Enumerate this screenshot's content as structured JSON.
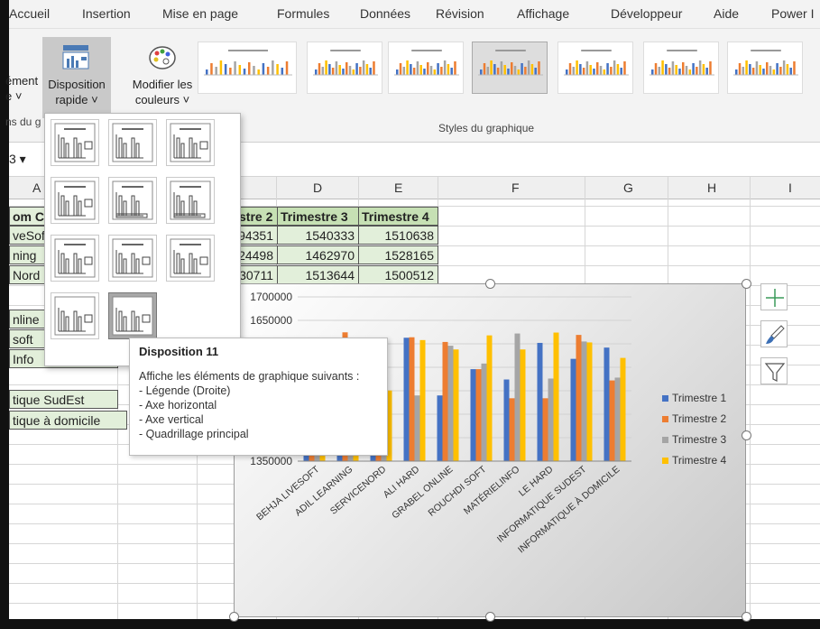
{
  "ribbon": {
    "tabs": [
      "Accueil",
      "Insertion",
      "Mise en page",
      "Formules",
      "Données",
      "Révision",
      "Affichage",
      "Développeur",
      "Aide",
      "Power I"
    ],
    "left_partial_top": "ément",
    "left_partial_bottom": "e ˅",
    "quick_layout_line1": "Disposition",
    "quick_layout_line2": "rapide ˅",
    "change_colors_line1": "Modifier les",
    "change_colors_line2": "couleurs ˅",
    "group_partial": "ns du g",
    "group_styles": "Styles du graphique"
  },
  "namebox": "3 ▾",
  "columns": [
    "A",
    "D",
    "E",
    "F",
    "G",
    "H",
    "I"
  ],
  "table": {
    "header_partial": "stre 2",
    "headers": [
      "Trimestre 3",
      "Trimestre 4"
    ],
    "col_a_header": "om Cl",
    "rows": [
      {
        "a": "veSoft",
        "c": "94351",
        "d": "1540333",
        "e": "1510638"
      },
      {
        "a": "ning",
        "c": "24498",
        "d": "1462970",
        "e": "1528165"
      },
      {
        "a": "Nord",
        "c": "30711",
        "d": "1513644",
        "e": "1500512"
      }
    ],
    "more_names": [
      "nline",
      "soft",
      "Info",
      "",
      "tique SudEst",
      "tique à domicile"
    ]
  },
  "dropdown": {
    "layouts": [
      "Disposition 1",
      "Disposition 2",
      "Disposition 3",
      "Disposition 4",
      "Disposition 5",
      "Disposition 6",
      "Disposition 7",
      "Disposition 8",
      "Disposition 9",
      "Disposition 10",
      "Disposition 11"
    ],
    "selected": "Disposition 11"
  },
  "tooltip": {
    "title": "Disposition 11",
    "intro": "Affiche les éléments de graphique suivants :",
    "items": [
      "- Légende (Droite)",
      "- Axe horizontal",
      "- Axe vertical",
      "- Quadrillage principal"
    ]
  },
  "chart_data": {
    "type": "bar",
    "categories": [
      "BEHJA LIVESOFT",
      "ADIL LEARNING",
      "SERVICENORD",
      "ALI HARD",
      "GRABEL ONLINE",
      "ROUCHDI SOFT",
      "MATÉRIELINFO",
      "LE HARD",
      "INFORMATIQUE SUDEST",
      "INFORMATIQUE À DOMICILE"
    ],
    "series": [
      {
        "name": "Trimestre 1",
        "color": "#4472c4",
        "values": [
          1555000,
          1560000,
          1535000,
          1613000,
          1490000,
          1546000,
          1524000,
          1602000,
          1568000,
          1592000
        ]
      },
      {
        "name": "Trimestre 2",
        "color": "#ed7d31",
        "values": [
          1594351,
          1624498,
          1530711,
          1614000,
          1604000,
          1546000,
          1484000,
          1484000,
          1619000,
          1522000
        ]
      },
      {
        "name": "Trimestre 3",
        "color": "#a5a5a5",
        "values": [
          1540333,
          1462970,
          1513644,
          1490000,
          1596000,
          1558000,
          1622000,
          1526000,
          1605000,
          1528000
        ]
      },
      {
        "name": "Trimestre 4",
        "color": "#ffc000",
        "values": [
          1510638,
          1528165,
          1500512,
          1608000,
          1588000,
          1618000,
          1588000,
          1624000,
          1603000,
          1570000
        ]
      }
    ],
    "y_ticks": [
      1350000,
      1650000,
      1700000
    ],
    "ylim": [
      1350000,
      1700000
    ],
    "grid": true,
    "legend": "right"
  },
  "side_buttons": [
    "plus-icon",
    "brush-icon",
    "filter-icon"
  ]
}
